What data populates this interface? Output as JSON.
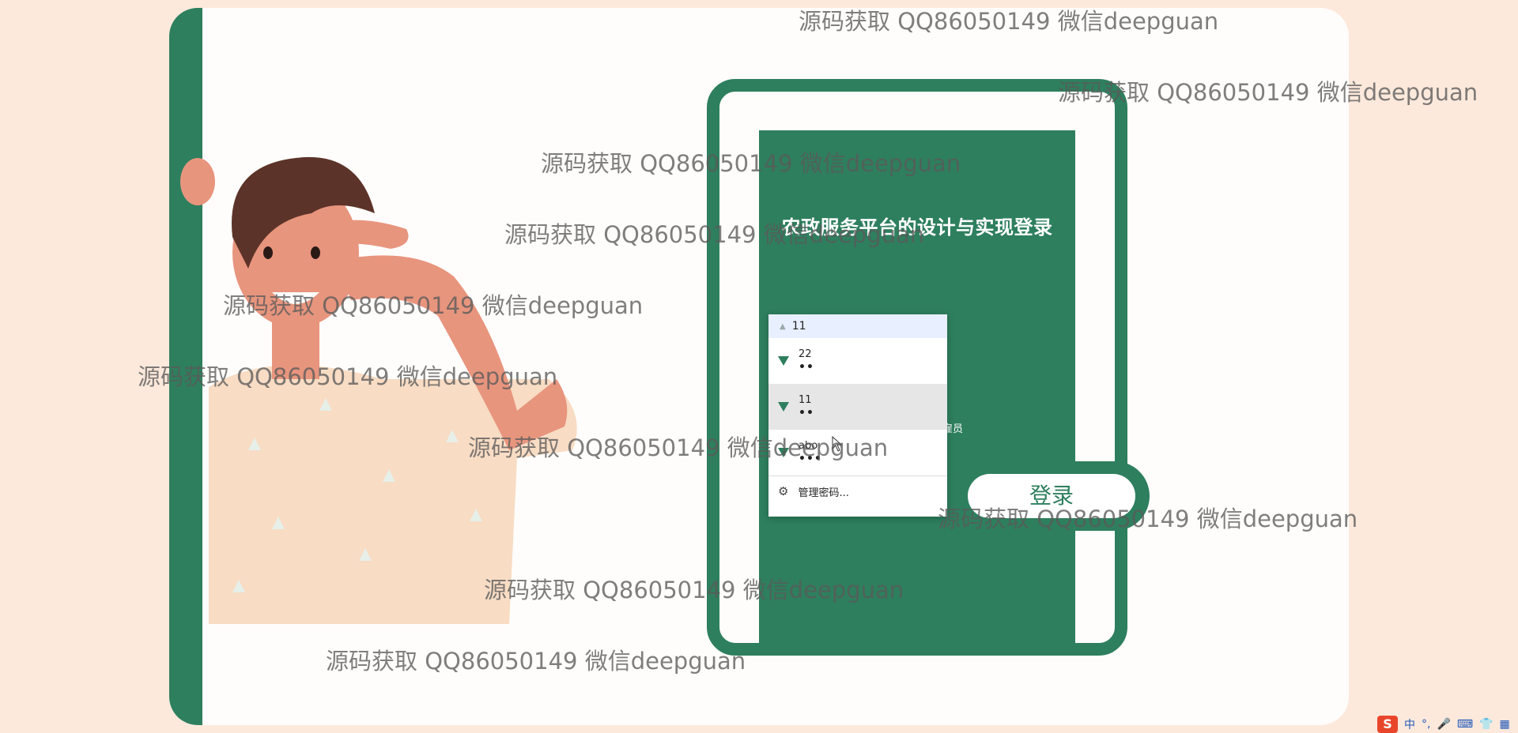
{
  "login": {
    "title": "农政服务平台的设计与实现登录",
    "role_hint": "雇员",
    "submit_label": "登录"
  },
  "autocomplete": {
    "input_value": "11",
    "items": [
      {
        "username": "22",
        "password_mask": "••"
      },
      {
        "username": "11",
        "password_mask": "••"
      },
      {
        "username": "abo",
        "password_mask": "•••"
      }
    ],
    "manage_label": "管理密码..."
  },
  "watermark": {
    "text": "源码获取 QQ86050149 微信deepguan"
  },
  "tray": {
    "ime_mode": "中",
    "punct": "°,",
    "mic": "🎤",
    "keyboard": "⌨",
    "shirt": "👕",
    "grid": "▦"
  },
  "colors": {
    "primary": "#2e7f5e",
    "background": "#fce9dc",
    "card": "#fffdfb"
  }
}
